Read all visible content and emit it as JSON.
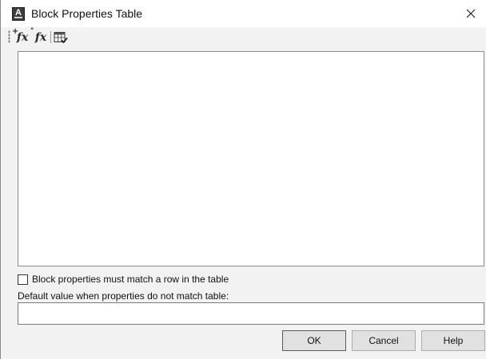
{
  "window": {
    "title": "Block Properties Table",
    "app_icon": "autocad-a-icon",
    "close_glyph": "×"
  },
  "toolbar": {
    "buttons": [
      {
        "name": "new-property-parameter-icon",
        "glyph": "fx"
      },
      {
        "name": "existing-parameter-icon",
        "glyph": "fx"
      },
      {
        "name": "audit-table-icon",
        "glyph": "table-check"
      }
    ]
  },
  "table": {
    "rows": []
  },
  "options": {
    "must_match_label": "Block properties must match a row in the table",
    "must_match_checked": false
  },
  "default_value": {
    "label": "Default value when properties do not match table:",
    "value": ""
  },
  "buttons": {
    "ok": "OK",
    "cancel": "Cancel",
    "help": "Help"
  },
  "colors": {
    "dialog_bg": "#f2f2f2",
    "button_bg": "#e1e1e1",
    "border": "#8c8c8c"
  }
}
